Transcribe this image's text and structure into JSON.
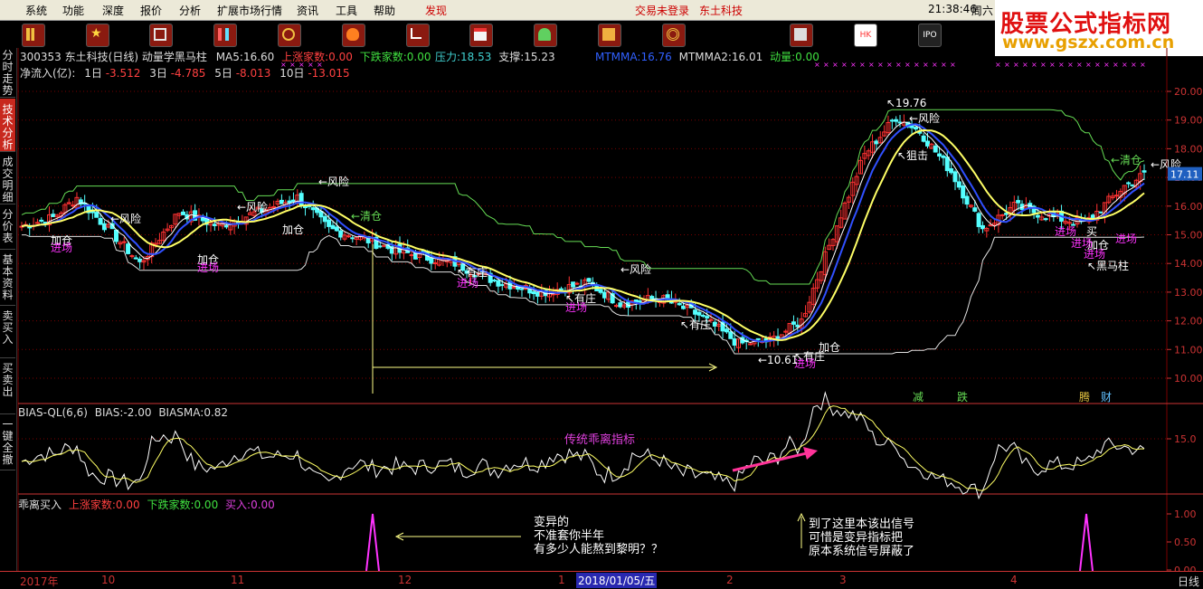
{
  "menu": {
    "items": [
      "系统",
      "功能",
      "深度",
      "报价",
      "分析",
      "扩展市场行情",
      "资讯",
      "工具",
      "帮助",
      "发现"
    ],
    "login_status": "交易未登录",
    "stock_name": "东土科技",
    "time": "21:38:46",
    "weekday": "周六"
  },
  "logo": {
    "line1": "股票公式指标网",
    "line2": "www.gszx.com.cn"
  },
  "toolbar": {
    "icons": [
      "bar-chart-icon",
      "star-icon",
      "grid-icon",
      "candle-icon",
      "radar-icon",
      "fire-icon",
      "chart-up-icon",
      "calendar-icon",
      "person-icon",
      "ticket-icon",
      "target-icon",
      "news-icon",
      "hk-icon",
      "ipo-icon"
    ],
    "labels": {
      "hk": "HK",
      "ipo": "IPO"
    }
  },
  "sidebar": {
    "tabs": [
      "分时走势",
      "技术分析",
      "成交明细",
      "分价表",
      "基本资料",
      "卖买入",
      "买卖出",
      "一键全撤"
    ],
    "active": 1
  },
  "main_panel": {
    "header": {
      "code": "300353",
      "name": "东土科技(日线)",
      "indicator": "动量学黑马柱",
      "ma5_label": "MA5:",
      "ma5": "16.60",
      "up_label": "上涨家数:",
      "up": "0.00",
      "down_label": "下跌家数:",
      "down": "0.00",
      "pressure_label": "压力:",
      "pressure": "18.53",
      "support_label": "支撑:",
      "support": "15.23",
      "mtmma_label": "MTMMA:",
      "mtmma": "16.76",
      "mtmma2_label": "MTMMA2:",
      "mtmma2": "16.01",
      "momentum_label": "动量:",
      "momentum": "0.00"
    },
    "netflow": {
      "label": "净流入(亿):",
      "d1_label": "1日",
      "d1": "-3.512",
      "d3_label": "3日",
      "d3": "-4.785",
      "d5_label": "5日",
      "d5": "-8.013",
      "d10_label": "10日",
      "d10": "-13.015"
    },
    "price_axis": [
      "20.00",
      "19.00",
      "18.00",
      "17.00",
      "16.00",
      "15.00",
      "14.00",
      "13.00",
      "12.00",
      "11.00",
      "10.00"
    ],
    "current_price": "17.11",
    "annotations": {
      "risk": "←风险",
      "add": "加仓",
      "enter": "进场",
      "clear": "←清仓",
      "dealer": "↖有庄",
      "buy": "买",
      "dark_horse": "↖黑马柱",
      "high": "↖19.76",
      "low": "←10.61",
      "sniper": "↖狙击",
      "reduce": "减",
      "fall": "跌",
      "surge": "腾",
      "wealth": "财"
    }
  },
  "bias_panel": {
    "title": "BIAS-QL(6,6)",
    "bias_label": "BIAS:",
    "bias": "-2.00",
    "biasma_label": "BIASMA:",
    "biasma": "0.82",
    "axis_label": "15.0",
    "note": "传统乖离指标"
  },
  "signal_panel": {
    "title": "乖离买入",
    "up_label": "上涨家数:",
    "up": "0.00",
    "down_label": "下跌家数:",
    "down": "0.00",
    "buy_label": "买入:",
    "buy": "0.00",
    "axis": [
      "1.00",
      "0.50",
      "0.00"
    ],
    "note1": [
      "变异的",
      "不准套你半年",
      "有多少人能熬到黎明？？"
    ],
    "note2": [
      "到了这里本该出信号",
      "可惜是变异指标把",
      "原本系统信号屏蔽了"
    ]
  },
  "date_axis": {
    "labels": [
      "2017年",
      "10",
      "11",
      "12",
      "1",
      "2",
      "3",
      "4"
    ],
    "cursor_date": "2018/01/05/五",
    "period": "日线"
  },
  "colors": {
    "up": "#ff3232",
    "down": "#54ffff",
    "ma_yellow": "#ffff66",
    "ma_blue": "#3050ff",
    "ma_white": "#ffffff",
    "green_line": "#66dd55",
    "magenta": "#ff33ff",
    "grid": "#7a0000"
  }
}
